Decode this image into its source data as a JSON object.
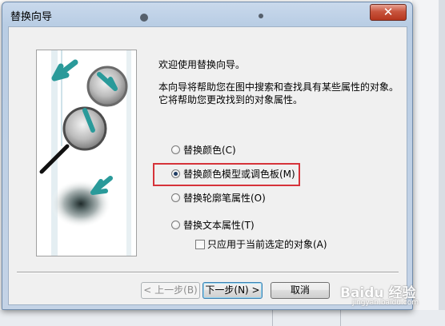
{
  "window": {
    "title": "替换向导",
    "close_glyph": "✕"
  },
  "welcome_text": "欢迎使用替换向导。",
  "description": "本向导将帮助您在图中搜索和查找具有某些属性的对象。它将帮助您更改找到的对象属性。",
  "options": [
    {
      "label": "替换颜色(C)",
      "checked": false
    },
    {
      "label": "替换颜色模型或调色板(M)",
      "checked": true
    },
    {
      "label": "替换轮廓笔属性(O)",
      "checked": false
    },
    {
      "label": "替换文本属性(T)",
      "checked": false
    }
  ],
  "checkbox": {
    "label": "只应用于当前选定的对象(A)",
    "checked": false
  },
  "buttons": {
    "back": "< 上一步(B)",
    "next": "下一步(N) >",
    "cancel": "取消"
  },
  "watermark": {
    "brand": "Baidu 经验",
    "url": "jingyan.baidu.com"
  },
  "colors": {
    "highlight": "#d6333a",
    "accent": "#2a9a9a"
  }
}
